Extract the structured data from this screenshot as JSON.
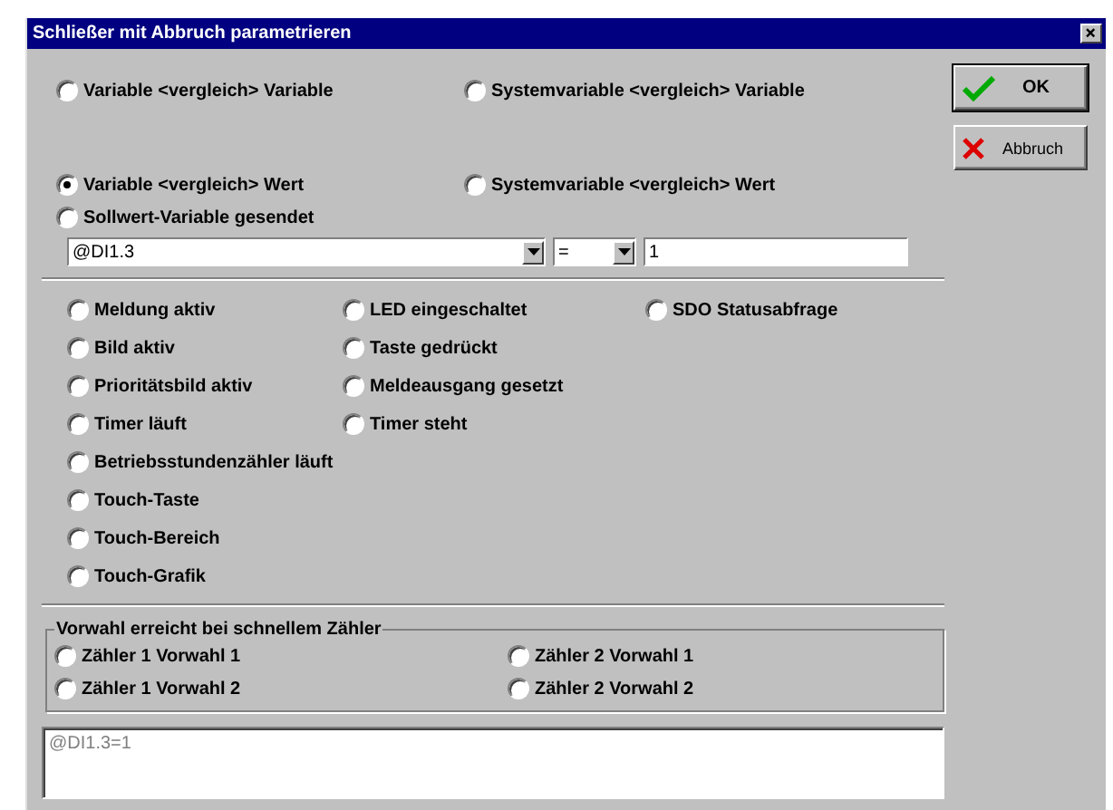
{
  "window": {
    "title": "Schließer mit Abbruch parametrieren"
  },
  "compare_options": [
    {
      "label": "Variable <vergleich> Variable",
      "selected": false
    },
    {
      "label": "Systemvariable <vergleich> Variable",
      "selected": false
    },
    {
      "label": "Variable <vergleich> Wert",
      "selected": true
    },
    {
      "label": "Systemvariable <vergleich> Wert",
      "selected": false
    },
    {
      "label": "Sollwert-Variable gesendet",
      "selected": false
    }
  ],
  "condition": {
    "variable": "@DI1.3",
    "operator": "=",
    "value": "1"
  },
  "state_columns": [
    [
      {
        "label": "Meldung aktiv",
        "selected": false
      },
      {
        "label": "Bild aktiv",
        "selected": false
      },
      {
        "label": "Prioritätsbild aktiv",
        "selected": false
      },
      {
        "label": "Timer läuft",
        "selected": false
      },
      {
        "label": "Betriebsstundenzähler läuft",
        "selected": false
      },
      {
        "label": "Touch-Taste",
        "selected": false
      },
      {
        "label": "Touch-Bereich",
        "selected": false
      },
      {
        "label": "Touch-Grafik",
        "selected": false
      }
    ],
    [
      {
        "label": "LED eingeschaltet",
        "selected": false
      },
      {
        "label": "Taste gedrückt",
        "selected": false
      },
      {
        "label": "Meldeausgang gesetzt",
        "selected": false
      },
      {
        "label": "Timer steht",
        "selected": false
      }
    ],
    [
      {
        "label": "SDO Statusabfrage",
        "selected": false
      }
    ]
  ],
  "preset_group": {
    "title": "Vorwahl erreicht bei schnellem Zähler",
    "options": [
      {
        "label": "Zähler 1 Vorwahl 1",
        "selected": false
      },
      {
        "label": "Zähler 2 Vorwahl 1",
        "selected": false
      },
      {
        "label": "Zähler 1 Vorwahl 2",
        "selected": false
      },
      {
        "label": "Zähler 2 Vorwahl 2",
        "selected": false
      }
    ]
  },
  "expression": "@DI1.3=1",
  "buttons": [
    {
      "kind": "ok",
      "label": "OK"
    },
    {
      "kind": "cancel",
      "label": "Abbruch"
    }
  ]
}
